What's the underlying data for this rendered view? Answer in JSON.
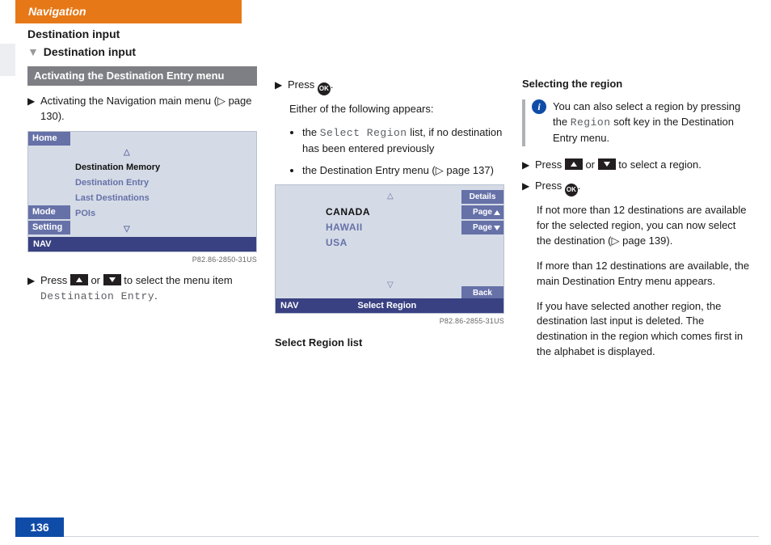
{
  "header": {
    "title": "Navigation",
    "page_number": "136"
  },
  "col1": {
    "section": "Destination input",
    "page_title_prefix": "▼",
    "page_title": "Destination input",
    "sub_header": "Activating the Destination Entry menu",
    "step1_a": "Activating the Navigation main menu (",
    "step1_pageref": "page 130",
    "step1_b": ").",
    "scr1": {
      "side": {
        "home": "Home",
        "mode": "Mode",
        "setting": "Setting"
      },
      "menu": {
        "up": "△",
        "items": [
          "Destination Memory",
          "Destination Entry",
          "Last Destinations",
          "POIs"
        ],
        "dn": "▽"
      },
      "nav": "NAV",
      "img_id": "P82.86-2850-31US"
    },
    "step2_a": "Press ",
    "step2_b": " or ",
    "step2_c": " to select the menu item ",
    "step2_code": "Destination Entry",
    "step2_d": "."
  },
  "col2": {
    "step1_a": "Press ",
    "step1_b": ".",
    "line1": "Either of the following appears:",
    "b1_a": "the ",
    "b1_code": "Select Region",
    "b1_b": " list, if no destination has been entered previously",
    "b2_a": "the Destination Entry menu (",
    "b2_pageref": "page 137",
    "b2_b": ")",
    "scr2": {
      "up": "△",
      "dn": "▽",
      "items": [
        "CANADA",
        "HAWAII",
        "USA"
      ],
      "rbtns": {
        "details": "Details",
        "page_up": "Page",
        "page_dn": "Page",
        "back": "Back"
      },
      "nav": "NAV",
      "nav_title": "Select Region",
      "img_id": "P82.86-2855-31US"
    },
    "caption": "Select Region list"
  },
  "col3": {
    "h3": "Selecting the region",
    "info_a": "You can also select a region by pressing the ",
    "info_code": "Region",
    "info_b": " soft key in the Destination Entry menu.",
    "step1_a": "Press ",
    "step1_b": " or ",
    "step1_c": " to select a region.",
    "step2_a": "Press ",
    "step2_b": ".",
    "p1_a": "If not more than 12 destinations are available for the selected region, you can now select the destination (",
    "p1_pageref": "page 139",
    "p1_b": ").",
    "p2": "If more than 12 destinations are available, the main Destination Entry menu appears.",
    "p3": "If you have selected another region, the destination last input is deleted. The destination in the region which comes first in the alphabet is displayed."
  },
  "glyphs": {
    "step": "▶",
    "pageref": "▷",
    "ok": "OK"
  }
}
